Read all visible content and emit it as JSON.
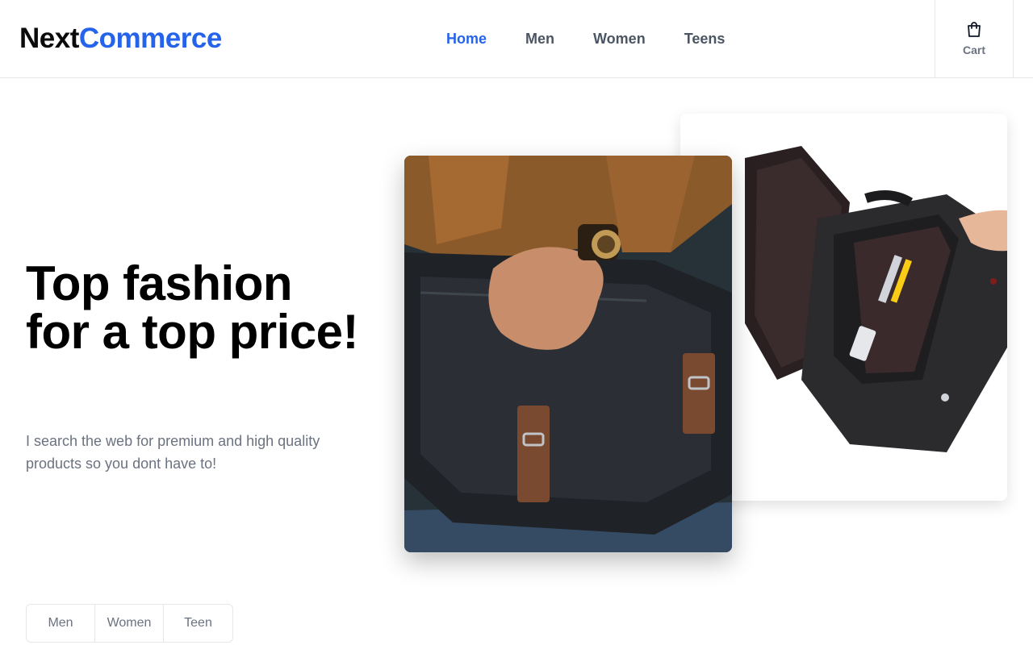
{
  "brand": {
    "part1": "Next",
    "part2": "Commerce"
  },
  "nav": {
    "items": [
      {
        "label": "Home",
        "active": true
      },
      {
        "label": "Men",
        "active": false
      },
      {
        "label": "Women",
        "active": false
      },
      {
        "label": "Teens",
        "active": false
      }
    ]
  },
  "cart": {
    "label": "Cart",
    "icon": "shopping-bag-icon"
  },
  "hero": {
    "title": "Top fashion for a top price!",
    "subtitle": "I search the web for premium and high quality products so you dont have to!"
  },
  "images": {
    "front": "messenger-bag-worn",
    "back": "messenger-bag-open"
  },
  "categories": {
    "tabs": [
      "Men",
      "Women",
      "Teen"
    ]
  },
  "colors": {
    "accent": "#2563eb",
    "text_muted": "#6b7280",
    "nav_text": "#4b5563"
  }
}
